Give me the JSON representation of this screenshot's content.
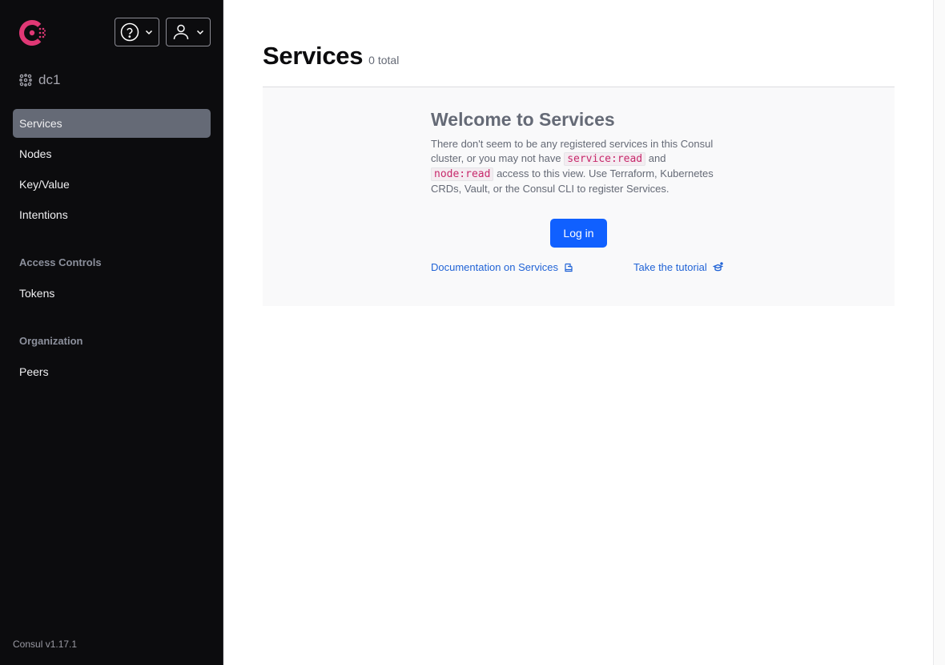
{
  "app": {
    "logo": "consul-logo",
    "help_menu_icon": "help-circle-icon",
    "user_menu_icon": "user-icon",
    "datacenter": "dc1",
    "version": "Consul v1.17.1"
  },
  "sidebar": {
    "items": [
      {
        "label": "Services",
        "active": true
      },
      {
        "label": "Nodes",
        "active": false
      },
      {
        "label": "Key/Value",
        "active": false
      },
      {
        "label": "Intentions",
        "active": false
      }
    ],
    "sections": [
      {
        "label": "Access Controls",
        "items": [
          {
            "label": "Tokens"
          }
        ]
      },
      {
        "label": "Organization",
        "items": [
          {
            "label": "Peers"
          }
        ]
      }
    ]
  },
  "main": {
    "title": "Services",
    "count": "0 total",
    "empty_state": {
      "title": "Welcome to Services",
      "body_1": "There don't seem to be any registered services in this Consul cluster, or you may not have ",
      "code_1": "service:read",
      "body_2": " and ",
      "code_2": "node:read",
      "body_3": " access to this view. Use Terraform, Kubernetes CRDs, Vault, or the Consul CLI to register Services.",
      "login_label": "Log in",
      "docs_link": "Documentation on Services",
      "tutorial_link": "Take the tutorial"
    }
  },
  "colors": {
    "brand": "#e03875",
    "primary": "#1060ff",
    "link": "#2264d6",
    "sidebar_bg": "#0c0c0e",
    "active_nav": "#656a76"
  }
}
